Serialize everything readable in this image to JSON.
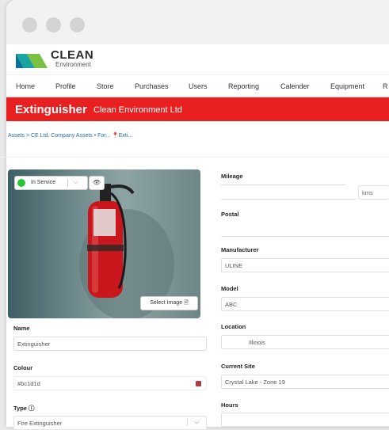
{
  "logo": {
    "line1": "CLEAN",
    "line2": "Environment"
  },
  "nav": {
    "items": [
      "Home",
      "Profile",
      "Store",
      "Purchases",
      "Users",
      "Reporting",
      "Calender",
      "Equipment",
      "R"
    ]
  },
  "header": {
    "title": "Extinguisher",
    "company": "Clean Environment Ltd"
  },
  "breadcrumb": {
    "text": "Assets > CE Ltd. Company Assets •  For... ",
    "pin": "📍",
    "tail": "Exti..."
  },
  "photo": {
    "status_label": "In Service",
    "select_image_label": "Select Image",
    "eye_glyph": "👁",
    "doc_glyph": "🗎"
  },
  "left_form": {
    "name_label": "Name",
    "name_value": "Extinguisher",
    "colour_label": "Colour",
    "colour_value": "#bc1d1d",
    "type_label": "Type ⓘ",
    "type_value": "Fire Extinguisher"
  },
  "right_form": {
    "mileage_label": "Mileage",
    "mileage_unit": "kms",
    "postal_label": "Postal",
    "manufacturer_label": "Manufacturer",
    "manufacturer_value": "ULINE",
    "model_label": "Model",
    "model_value": "ABC",
    "location_label": "Location",
    "location_value": "Illinois",
    "site_label": "Current Site",
    "site_value": "Crystal Lake - Zone 19",
    "hours_label": "Hours"
  },
  "colors": {
    "brand_red": "#e8201f",
    "status_green": "#29c339",
    "swatch": "#b03a48"
  }
}
